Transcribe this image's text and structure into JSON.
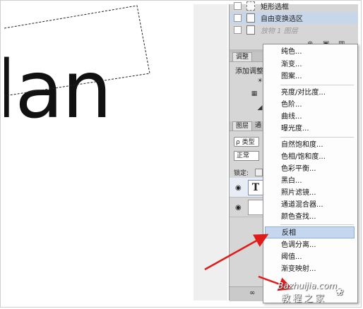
{
  "canvas": {
    "text": "lan"
  },
  "history": {
    "items": [
      {
        "label": "矩形选框",
        "state": "normal"
      },
      {
        "label": "自由变换选区",
        "state": "selected"
      },
      {
        "label": "放物 1 图层",
        "state": "dimmed"
      }
    ]
  },
  "adjustments": {
    "tab_label": "调整",
    "title": "添加调整"
  },
  "layers": {
    "tab_label": "图层",
    "tab2_label": "通",
    "search_label": "ρ 类型",
    "blend_mode": "正常",
    "lock_label": "锁定:",
    "text_thumb": "T"
  },
  "menu": {
    "items": [
      "纯色...",
      "渐变...",
      "图案...",
      "亮度/对比度...",
      "色阶...",
      "曲线...",
      "曝光度...",
      "自然饱和度...",
      "色相/饱和度...",
      "色彩平衡...",
      "黑白...",
      "照片滤镜...",
      "通道混合器...",
      "颜色查找...",
      "反相",
      "色调分离...",
      "阈值...",
      "渐变映射..."
    ],
    "highlighted": "反相"
  },
  "watermark": {
    "line1": "Bazhuijia.com",
    "line2": "教程之家"
  },
  "colors": {
    "arrow": "#e11a1a",
    "menu_highlight": "#c4d7ee"
  }
}
